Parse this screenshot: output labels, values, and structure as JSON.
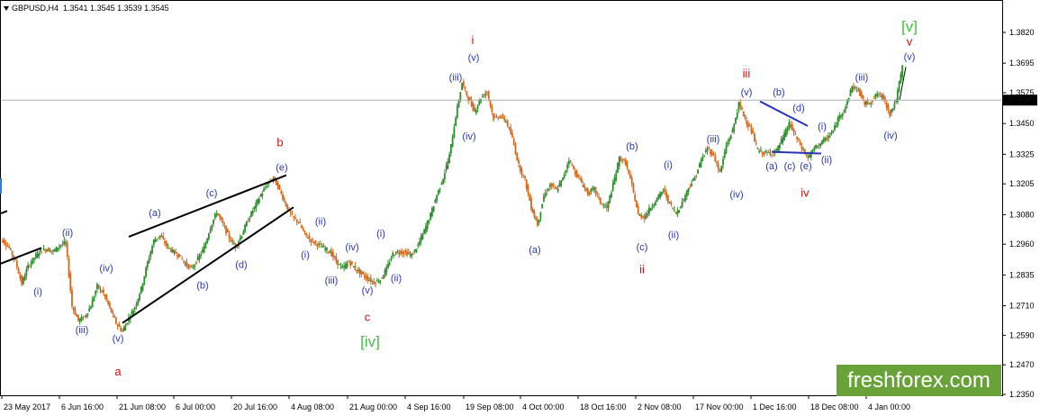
{
  "header": {
    "symbol": "GBPUSD,H4",
    "ohlc": "1.3541 1.3545 1.3539 1.3545"
  },
  "brand": {
    "text": "freshforex.com"
  },
  "colors": {
    "up": "#2e8b2e",
    "down": "#d2691e",
    "wave_blue": "#2b35b5",
    "wave_red": "#d01010",
    "wave_green": "#3fbf3f",
    "trendline": "#000000",
    "price_badge": "#000000"
  },
  "chart_data": {
    "type": "line",
    "title": "",
    "xlabel": "",
    "ylabel": "",
    "ylim": [
      1.235,
      1.388
    ],
    "grid": false,
    "y_ticks": [
      1.382,
      1.3695,
      1.3575,
      1.345,
      1.3325,
      1.3205,
      1.308,
      1.296,
      1.2835,
      1.271,
      1.259,
      1.247,
      1.235
    ],
    "y_tick_labels": [
      "1.3820",
      "1.3695",
      "1.3575",
      "1.3450",
      "1.3325",
      "1.3205",
      "1.3080",
      "1.2960",
      "1.2835",
      "1.2710",
      "1.2590",
      "1.2470",
      "1.2350"
    ],
    "current_price": 1.3545,
    "current_price_label": "1.3545",
    "x_tick_labels": [
      "23 May 2017",
      "6 Jun 16:00",
      "21 Jun 08:00",
      "6 Jul 00:00",
      "20 Jul 16:00",
      "4 Aug 08:00",
      "21 Aug 00:00",
      "4 Sep 16:00",
      "19 Sep 08:00",
      "4 Oct 00:00",
      "18 Oct 16:00",
      "2 Nov 08:00",
      "17 Nov 00:00",
      "1 Dec 16:00",
      "18 Dec 08:00",
      "4 Jan 00:00"
    ],
    "series": [
      {
        "values": [
          1.2975,
          1.2945,
          1.289,
          1.28,
          1.287,
          1.2905,
          1.2935,
          1.294,
          1.293,
          1.2955,
          1.2965,
          1.271,
          1.265,
          1.2665,
          1.271,
          1.279,
          1.276,
          1.27,
          1.264,
          1.2605,
          1.266,
          1.2705,
          1.278,
          1.2885,
          1.2975,
          1.2995,
          1.2955,
          1.293,
          1.2915,
          1.288,
          1.286,
          1.29,
          1.2945,
          1.303,
          1.309,
          1.304,
          1.2985,
          1.295,
          1.3,
          1.306,
          1.311,
          1.316,
          1.32,
          1.323,
          1.318,
          1.312,
          1.307,
          1.305,
          1.3,
          1.2975,
          1.296,
          1.2945,
          1.293,
          1.289,
          1.286,
          1.289,
          1.286,
          1.284,
          1.282,
          1.2805,
          1.2815,
          1.286,
          1.292,
          1.293,
          1.2925,
          1.2915,
          1.2955,
          1.3015,
          1.308,
          1.316,
          1.323,
          1.332,
          1.348,
          1.3615,
          1.355,
          1.35,
          1.3555,
          1.358,
          1.347,
          1.348,
          1.346,
          1.339,
          1.328,
          1.322,
          1.311,
          1.304,
          1.3155,
          1.32,
          1.318,
          1.3225,
          1.3305,
          1.325,
          1.321,
          1.3165,
          1.3185,
          1.313,
          1.3105,
          1.32,
          1.331,
          1.329,
          1.32,
          1.308,
          1.307,
          1.311,
          1.3145,
          1.318,
          1.3125,
          1.3085,
          1.313,
          1.319,
          1.323,
          1.33,
          1.335,
          1.332,
          1.325,
          1.336,
          1.342,
          1.353,
          1.347,
          1.342,
          1.334,
          1.333,
          1.333,
          1.334,
          1.339,
          1.345,
          1.34,
          1.335,
          1.331,
          1.335,
          1.337,
          1.339,
          1.342,
          1.348,
          1.352,
          1.36,
          1.3585,
          1.353,
          1.354,
          1.357,
          1.3555,
          1.349,
          1.3545,
          1.368
        ]
      }
    ],
    "trendlines": [
      {
        "from": [
          143,
          1.299
        ],
        "to": [
          318,
          1.324
        ]
      },
      {
        "from": [
          136,
          1.264
        ],
        "to": [
          326,
          1.311
        ]
      },
      {
        "from": [
          1,
          1.3085
        ],
        "to": [
          8,
          1.3095
        ]
      },
      {
        "from": [
          0,
          1.288
        ],
        "to": [
          46,
          1.2945
        ]
      },
      {
        "from": [
          844,
          1.354
        ],
        "to": [
          897,
          1.344
        ]
      },
      {
        "from": [
          857,
          1.3335
        ],
        "to": [
          912,
          1.3328
        ]
      }
    ],
    "annotations": [
      {
        "text": "(i)",
        "x": 42,
        "y": 1.2765,
        "color": "blue"
      },
      {
        "text": "(ii)",
        "x": 75,
        "y": 1.3005,
        "color": "blue"
      },
      {
        "text": "(iii)",
        "x": 91,
        "y": 1.261,
        "color": "blue"
      },
      {
        "text": "(iv)",
        "x": 118,
        "y": 1.286,
        "color": "blue"
      },
      {
        "text": "(v)",
        "x": 131,
        "y": 1.2575,
        "color": "blue"
      },
      {
        "text": "a",
        "x": 131,
        "y": 1.244,
        "color": "red"
      },
      {
        "text": "(a)",
        "x": 172,
        "y": 1.3085,
        "color": "blue"
      },
      {
        "text": "(b)",
        "x": 225,
        "y": 1.279,
        "color": "blue"
      },
      {
        "text": "(c)",
        "x": 235,
        "y": 1.3165,
        "color": "blue"
      },
      {
        "text": "(d)",
        "x": 268,
        "y": 1.2875,
        "color": "blue"
      },
      {
        "text": "(e)",
        "x": 313,
        "y": 1.327,
        "color": "blue"
      },
      {
        "text": "b",
        "x": 311,
        "y": 1.337,
        "color": "red"
      },
      {
        "text": "(ii)",
        "x": 356,
        "y": 1.305,
        "color": "blue"
      },
      {
        "text": "(i)",
        "x": 339,
        "y": 1.2915,
        "color": "blue"
      },
      {
        "text": "(iv)",
        "x": 391,
        "y": 1.2945,
        "color": "blue"
      },
      {
        "text": "(iii)",
        "x": 368,
        "y": 1.281,
        "color": "blue"
      },
      {
        "text": "(i)",
        "x": 423,
        "y": 1.3,
        "color": "blue"
      },
      {
        "text": "(ii)",
        "x": 440,
        "y": 1.282,
        "color": "blue"
      },
      {
        "text": "(v)",
        "x": 408,
        "y": 1.277,
        "color": "blue"
      },
      {
        "text": "c",
        "x": 408,
        "y": 1.266,
        "color": "red"
      },
      {
        "text": "[iv]",
        "x": 411,
        "y": 1.256,
        "color": "green"
      },
      {
        "text": "(iii)",
        "x": 506,
        "y": 1.3635,
        "color": "blue"
      },
      {
        "text": "(v)",
        "x": 526,
        "y": 1.3715,
        "color": "blue"
      },
      {
        "text": "i",
        "x": 525,
        "y": 1.3785,
        "color": "red"
      },
      {
        "text": "(iv)",
        "x": 521,
        "y": 1.3395,
        "color": "blue"
      },
      {
        "text": "(a)",
        "x": 594,
        "y": 1.2935,
        "color": "blue"
      },
      {
        "text": "(b)",
        "x": 702,
        "y": 1.3355,
        "color": "blue"
      },
      {
        "text": "(c)",
        "x": 713,
        "y": 1.2945,
        "color": "blue"
      },
      {
        "text": "ii",
        "x": 713,
        "y": 1.2855,
        "color": "red"
      },
      {
        "text": "(i)",
        "x": 742,
        "y": 1.328,
        "color": "blue"
      },
      {
        "text": "(ii)",
        "x": 748,
        "y": 1.2995,
        "color": "blue"
      },
      {
        "text": "(iii)",
        "x": 792,
        "y": 1.3385,
        "color": "blue"
      },
      {
        "text": "(iv)",
        "x": 818,
        "y": 1.316,
        "color": "blue"
      },
      {
        "text": "(v)",
        "x": 829,
        "y": 1.3575,
        "color": "blue"
      },
      {
        "text": "iii",
        "x": 829,
        "y": 1.365,
        "color": "red"
      },
      {
        "text": "(b)",
        "x": 865,
        "y": 1.3575,
        "color": "blue"
      },
      {
        "text": "(d)",
        "x": 887,
        "y": 1.351,
        "color": "blue"
      },
      {
        "text": "(i)",
        "x": 913,
        "y": 1.3435,
        "color": "blue"
      },
      {
        "text": "(a)",
        "x": 857,
        "y": 1.3275,
        "color": "blue"
      },
      {
        "text": "(c)",
        "x": 877,
        "y": 1.3275,
        "color": "blue"
      },
      {
        "text": "(e)",
        "x": 895,
        "y": 1.3275,
        "color": "blue"
      },
      {
        "text": "(ii)",
        "x": 918,
        "y": 1.33,
        "color": "blue"
      },
      {
        "text": "iv",
        "x": 894,
        "y": 1.3165,
        "color": "red"
      },
      {
        "text": "(iii)",
        "x": 957,
        "y": 1.3635,
        "color": "blue"
      },
      {
        "text": "(iv)",
        "x": 989,
        "y": 1.34,
        "color": "blue"
      },
      {
        "text": "(v)",
        "x": 1010,
        "y": 1.372,
        "color": "blue"
      },
      {
        "text": "v",
        "x": 1010,
        "y": 1.378,
        "color": "red"
      },
      {
        "text": "[v]",
        "x": 1010,
        "y": 1.384,
        "color": "green"
      }
    ]
  }
}
